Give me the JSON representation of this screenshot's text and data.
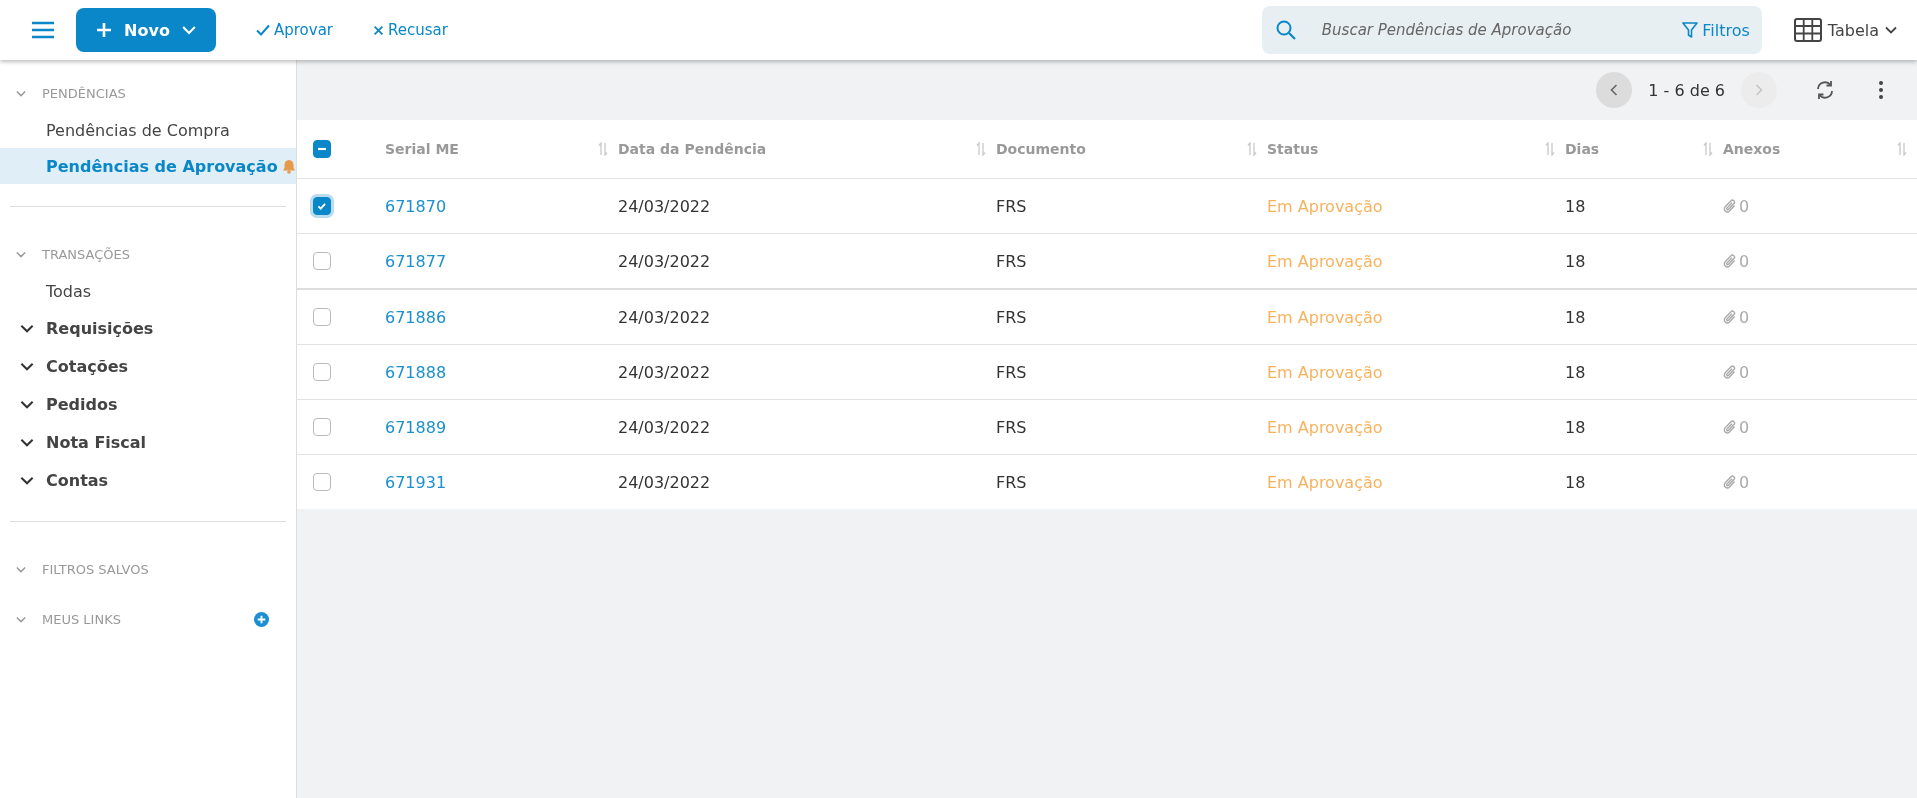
{
  "toolbar": {
    "new_button": "Novo",
    "approve": "Aprovar",
    "reject": "Recusar",
    "search": {
      "placeholder": "Buscar Pendências de Aprovação"
    },
    "filters": "Filtros",
    "view": "Tabela"
  },
  "sidebar": {
    "sections": [
      {
        "title": "PENDÊNCIAS",
        "items": [
          {
            "label": "Pendências de Compra",
            "selected": false,
            "bell": false,
            "kind": "link"
          },
          {
            "label": "Pendências de Aprovação",
            "selected": true,
            "bell": true,
            "kind": "link"
          }
        ]
      },
      {
        "title": "TRANSAÇÕES",
        "items": [
          {
            "label": "Todas",
            "selected": false,
            "bell": false,
            "kind": "link"
          },
          {
            "label": "Requisições",
            "selected": false,
            "bell": false,
            "kind": "group"
          },
          {
            "label": "Cotações",
            "selected": false,
            "bell": false,
            "kind": "group"
          },
          {
            "label": "Pedidos",
            "selected": false,
            "bell": false,
            "kind": "group"
          },
          {
            "label": "Nota Fiscal",
            "selected": false,
            "bell": false,
            "kind": "group"
          },
          {
            "label": "Contas",
            "selected": false,
            "bell": false,
            "kind": "group"
          }
        ]
      },
      {
        "title": "FILTROS SALVOS",
        "add": false
      },
      {
        "title": "MEUS LINKS",
        "add": true
      }
    ]
  },
  "pagination": {
    "range": "1 - 6 de 6",
    "prev_disabled": false,
    "next_disabled": true
  },
  "table": {
    "select_all_partial": true,
    "columns": [
      "Serial ME",
      "Data da Pendência",
      "Documento",
      "Status",
      "Dias",
      "Anexos"
    ],
    "rows": [
      {
        "selected": true,
        "serial": "671870",
        "date": "24/03/2022",
        "document": "FRS",
        "status": "Em Aprovação",
        "days": "18",
        "attachments": "0"
      },
      {
        "selected": false,
        "serial": "671877",
        "date": "24/03/2022",
        "document": "FRS",
        "status": "Em Aprovação",
        "days": "18",
        "attachments": "0"
      },
      {
        "selected": false,
        "serial": "671886",
        "date": "24/03/2022",
        "document": "FRS",
        "status": "Em Aprovação",
        "days": "18",
        "attachments": "0"
      },
      {
        "selected": false,
        "serial": "671888",
        "date": "24/03/2022",
        "document": "FRS",
        "status": "Em Aprovação",
        "days": "18",
        "attachments": "0"
      },
      {
        "selected": false,
        "serial": "671889",
        "date": "24/03/2022",
        "document": "FRS",
        "status": "Em Aprovação",
        "days": "18",
        "attachments": "0"
      },
      {
        "selected": false,
        "serial": "671931",
        "date": "24/03/2022",
        "document": "FRS",
        "status": "Em Aprovação",
        "days": "18",
        "attachments": "0"
      }
    ]
  }
}
